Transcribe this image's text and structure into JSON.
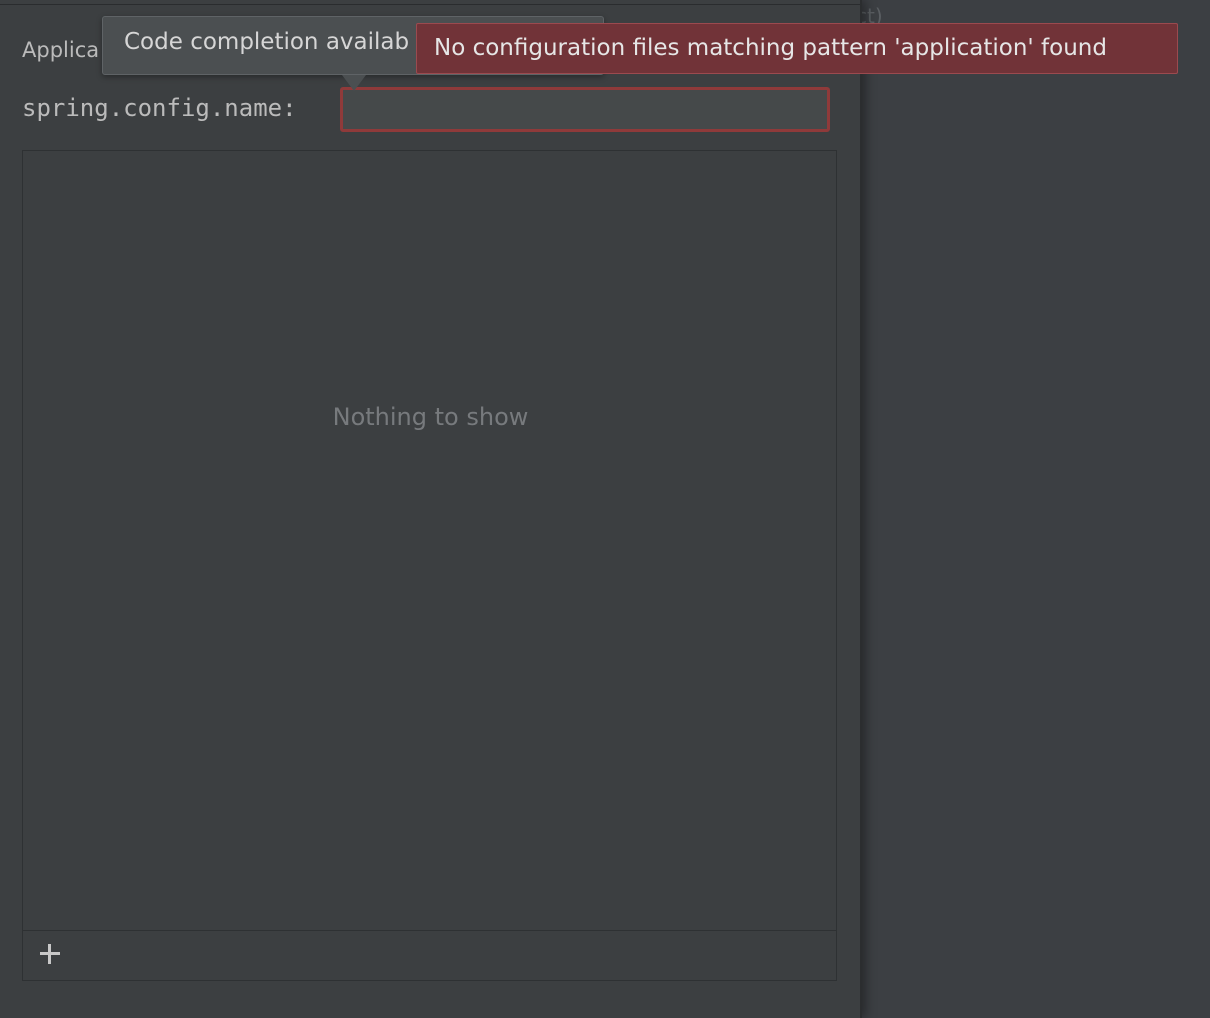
{
  "background": {
    "partial_text": "ct)"
  },
  "dialog": {
    "application_label": "Applica",
    "field_label": "spring.config.name:",
    "field_value": "",
    "list": {
      "empty_text": "Nothing to show"
    },
    "toolbar": {
      "add_icon": "plus-icon"
    }
  },
  "tooltip": {
    "text": "Code completion availab"
  },
  "error_balloon": {
    "text": "No configuration files matching pattern 'application' found"
  },
  "colors": {
    "error_border": "#8f3a3a",
    "error_background": "#713338",
    "panel_background": "#3c3f41"
  }
}
